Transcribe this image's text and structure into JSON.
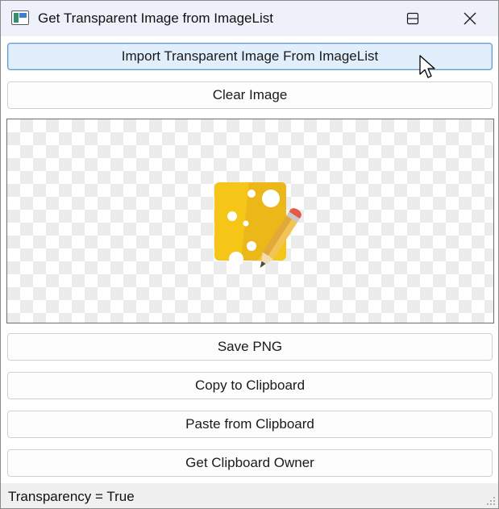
{
  "window": {
    "title": "Get Transparent Image from ImageList",
    "icon": "app-window-icon"
  },
  "buttons": {
    "import_label": "Import Transparent Image From ImageList",
    "clear_label": "Clear Image",
    "save_label": "Save PNG",
    "copy_label": "Copy to Clipboard",
    "paste_label": "Paste from Clipboard",
    "owner_label": "Get Clipboard Owner"
  },
  "image": {
    "icon": "cheese-pencil-icon",
    "background": "transparency-checkerboard"
  },
  "status": {
    "text": "Transparency = True"
  },
  "colors": {
    "focus_border": "#5d9ad6",
    "focus_fill": "#e1eefb",
    "cheese": "#f5c518",
    "pencil_tip": "#e4594a"
  }
}
